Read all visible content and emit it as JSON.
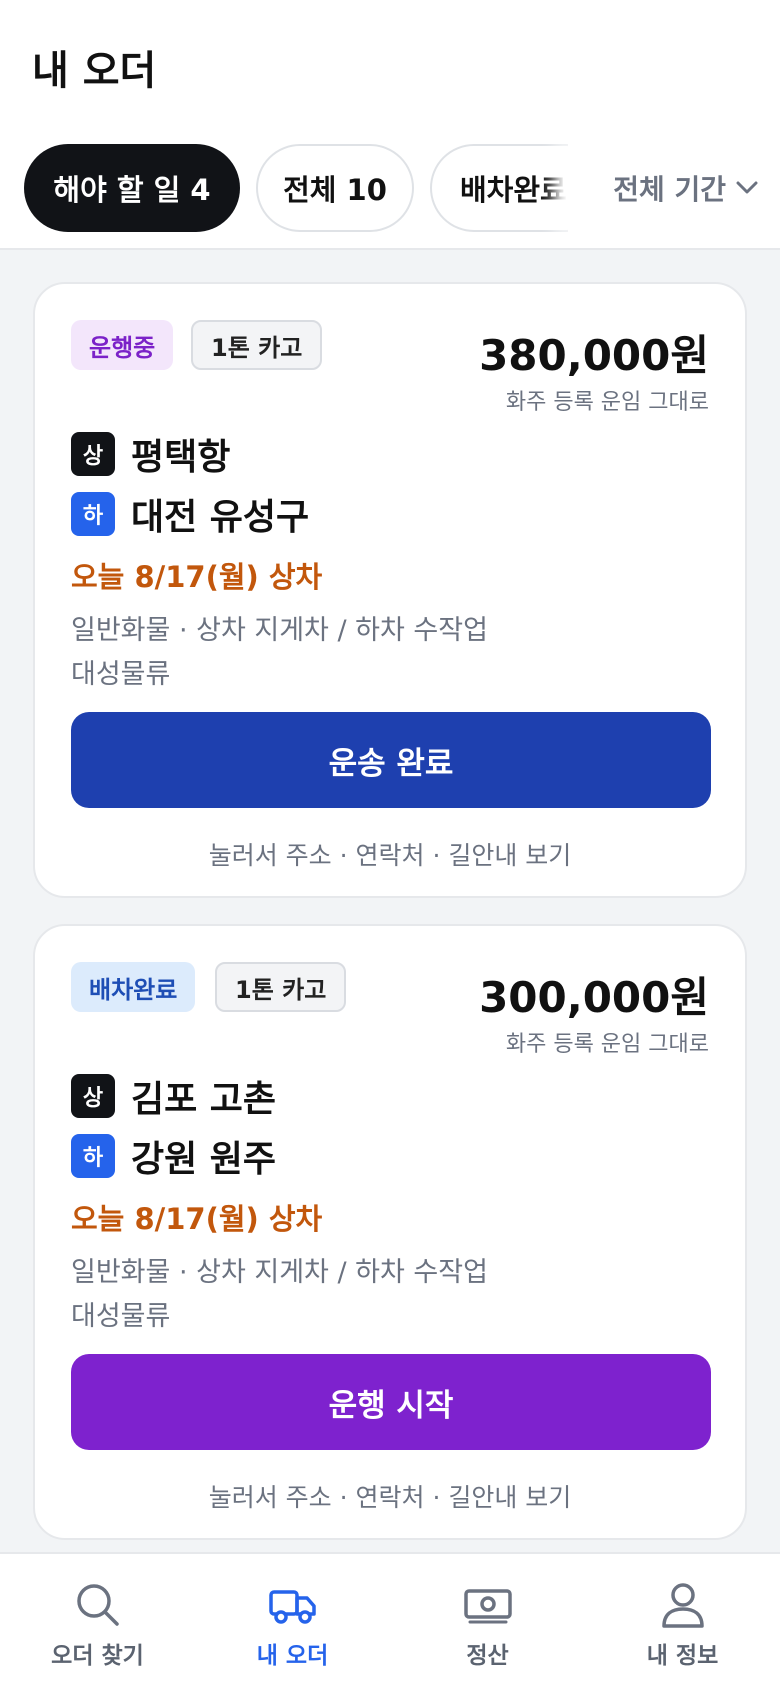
{
  "header": {
    "title": "내 오더"
  },
  "filters": {
    "chips": [
      {
        "label": "해야 할 일 4",
        "selected": true
      },
      {
        "label": "전체 10",
        "selected": false
      },
      {
        "label": "배차완료",
        "selected": false
      }
    ],
    "period": {
      "label": "전체 기간"
    }
  },
  "orders": [
    {
      "status": "운행중",
      "truck": "1톤 카고",
      "price": "380,000원",
      "price_note": "화주 등록 운임 그대로",
      "pickup_tag": "상",
      "pickup": "평택항",
      "drop_tag": "하",
      "drop": "대전 유성구",
      "load_date": "오늘 8/17(월) 상차",
      "cargo": "일반화물 · 상차 지게차 / 하차 수작업",
      "shipper": "대성물류",
      "action": "운송 완료",
      "detail": "눌러서 주소 · 연락처 · 길안내 보기"
    },
    {
      "status": "배차완료",
      "truck": "1톤 카고",
      "price": "300,000원",
      "price_note": "화주 등록 운임 그대로",
      "pickup_tag": "상",
      "pickup": "김포 고촌",
      "drop_tag": "하",
      "drop": "강원 원주",
      "load_date": "오늘 8/17(월) 상차",
      "cargo": "일반화물 · 상차 지게차 / 하차 수작업",
      "shipper": "대성물류",
      "action": "운행 시작",
      "detail": "눌러서 주소 · 연락처 · 길안내 보기"
    }
  ],
  "colors": {
    "accent_blue": "#2563eb",
    "complete_button": "#1e40af",
    "start_button": "#7e22ce",
    "running_badge_text": "#7b22c8",
    "assigned_badge_text": "#1e4eb5",
    "load_date": "#c2570c"
  },
  "tabbar": {
    "tabs": [
      {
        "label": "오더 찾기",
        "icon": "search-icon",
        "active": false
      },
      {
        "label": "내 오더",
        "icon": "truck-icon",
        "active": true
      },
      {
        "label": "정산",
        "icon": "money-icon",
        "active": false
      },
      {
        "label": "내 정보",
        "icon": "user-icon",
        "active": false
      }
    ]
  }
}
